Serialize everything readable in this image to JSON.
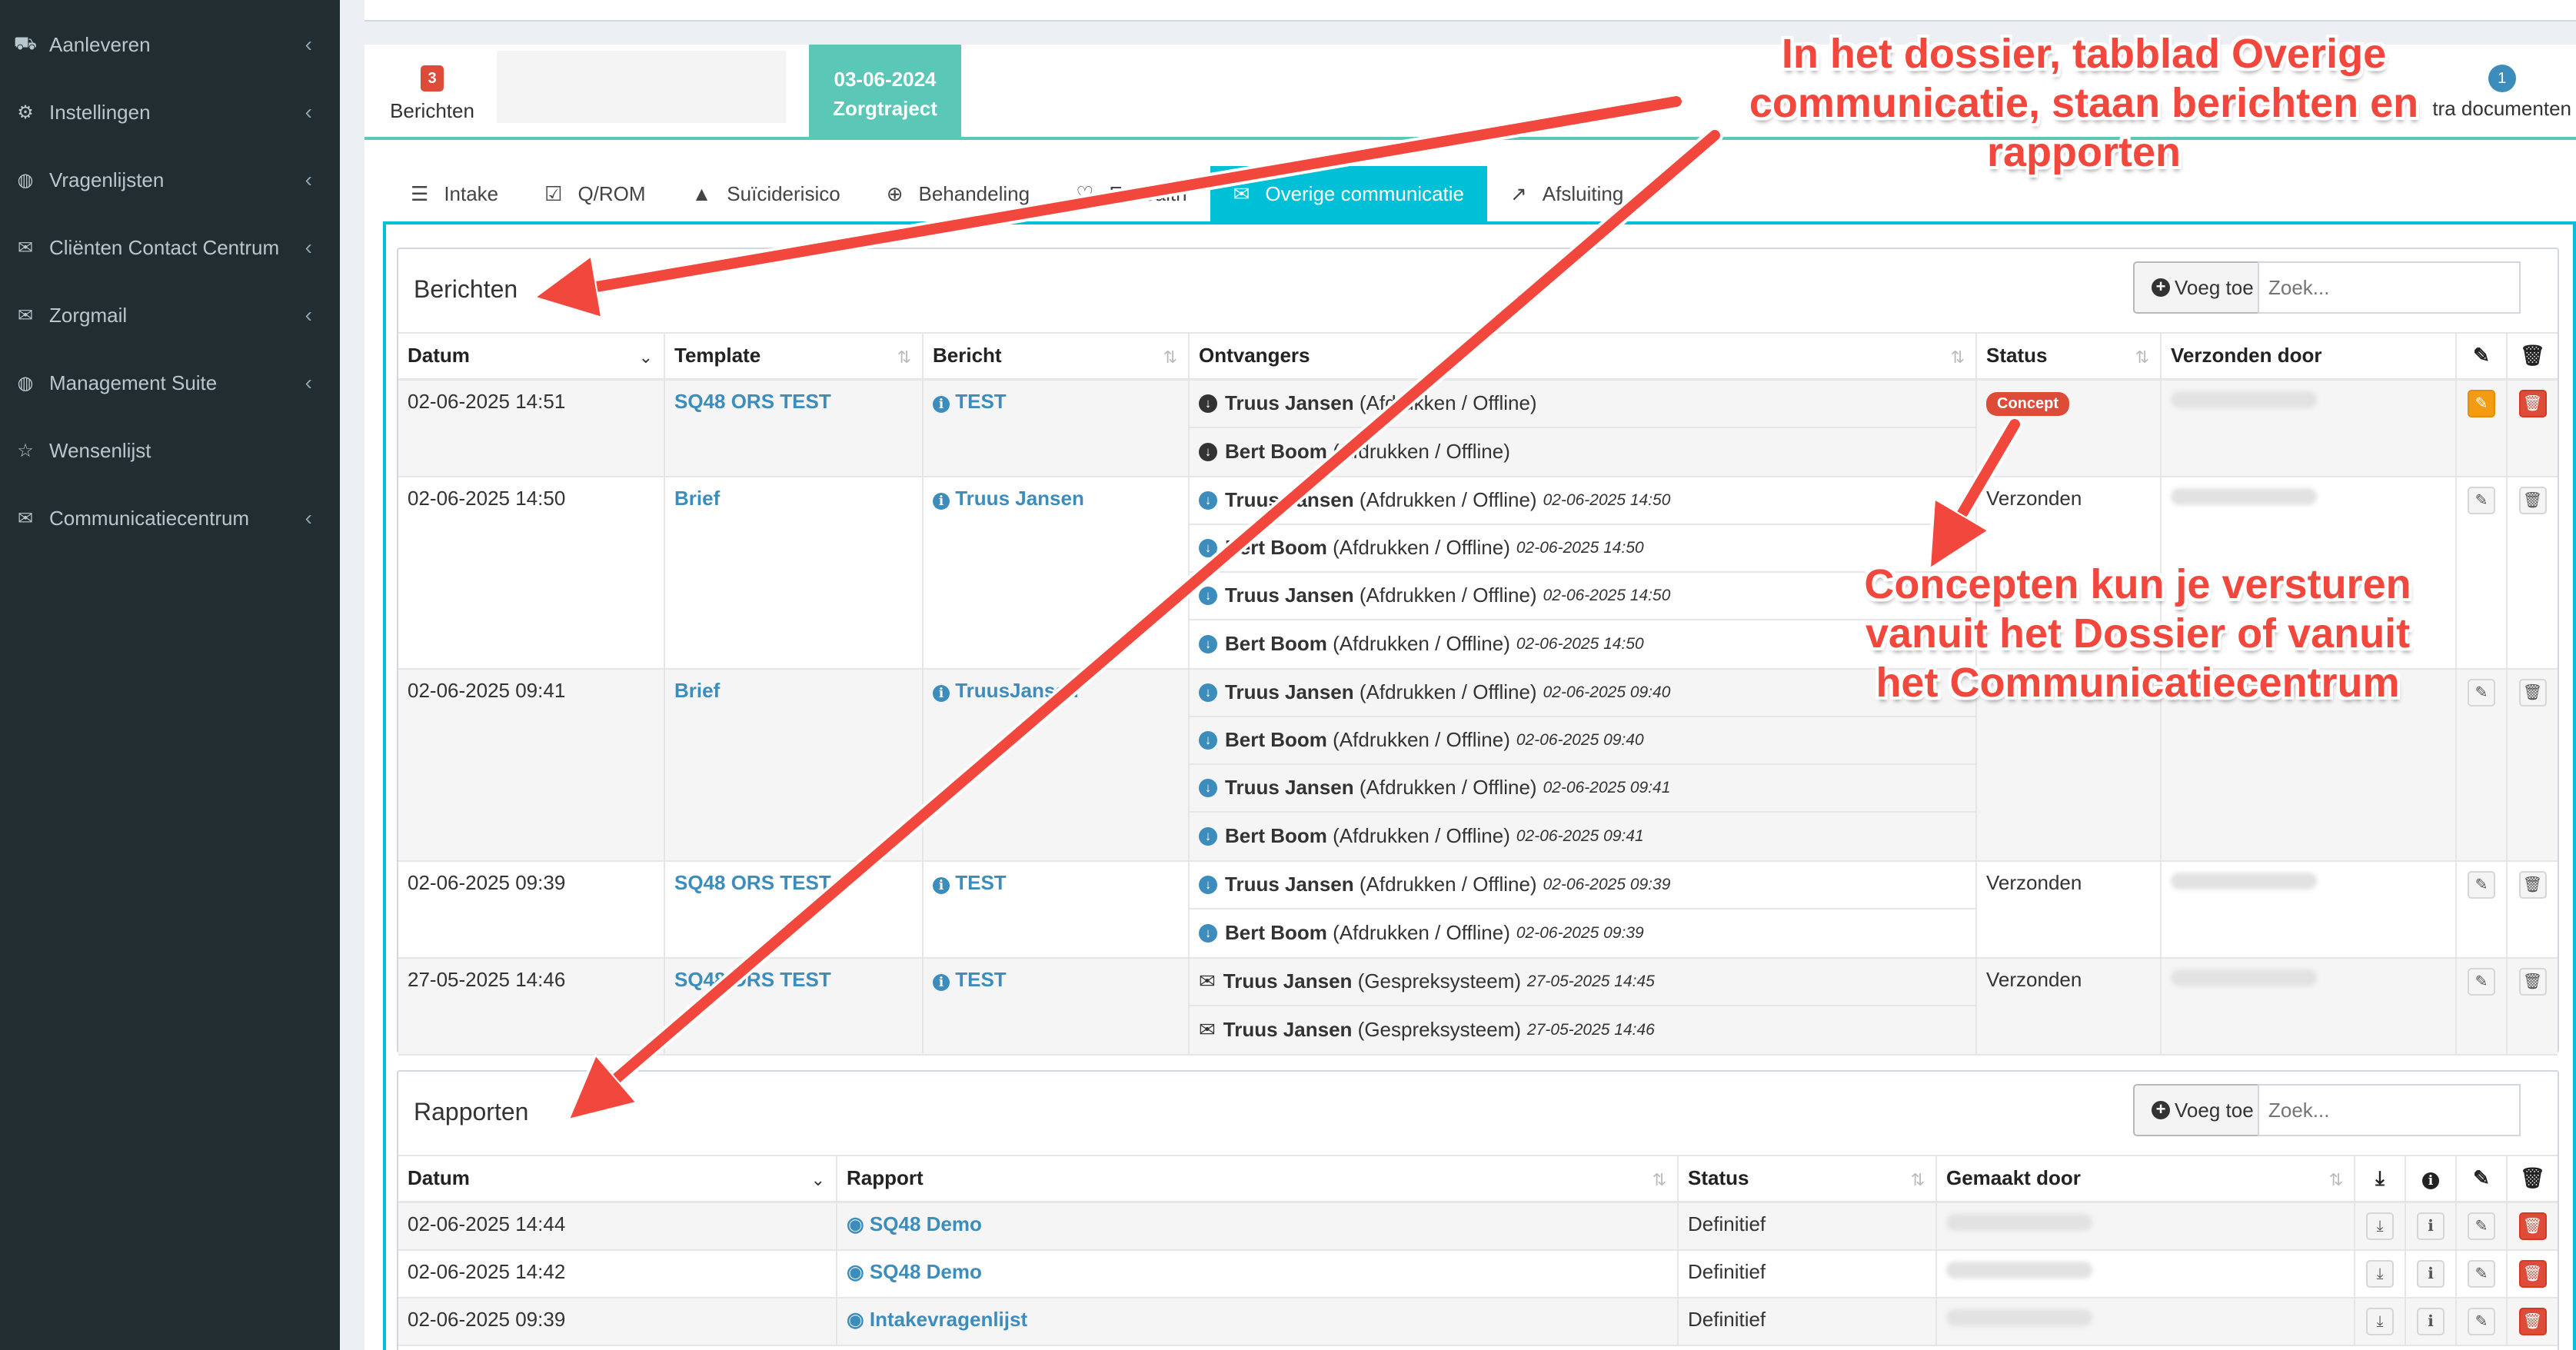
{
  "sidebar": {
    "items": [
      {
        "label": "Aanleveren",
        "icon": "truck-icon",
        "glyph": "⛟"
      },
      {
        "label": "Instellingen",
        "icon": "gear-icon",
        "glyph": "⚙"
      },
      {
        "label": "Vragenlijsten",
        "icon": "globe-icon",
        "glyph": "◍"
      },
      {
        "label": "Cliënten Contact Centrum",
        "icon": "envelope-icon",
        "glyph": "✉"
      },
      {
        "label": "Zorgmail",
        "icon": "envelope-icon",
        "glyph": "✉"
      },
      {
        "label": "Management Suite",
        "icon": "globe-icon",
        "glyph": "◍"
      },
      {
        "label": "Wensenlijst",
        "icon": "star-icon",
        "glyph": "☆"
      },
      {
        "label": "Communicatiecentrum",
        "icon": "envelope-icon",
        "glyph": "✉"
      }
    ]
  },
  "timeline": {
    "berichten_count": "3",
    "berichten_label": "Berichten",
    "active_date": "03-06-2024",
    "active_label": "Zorgtraject",
    "extra_count": "1",
    "extra_label": "tra documenten"
  },
  "tabs": [
    {
      "label": "Intake",
      "icon": "sliders-icon",
      "glyph": "☰"
    },
    {
      "label": "Q/ROM",
      "icon": "checkbox-icon",
      "glyph": "☑"
    },
    {
      "label": "Suïciderisico",
      "icon": "warning-icon",
      "glyph": "▲"
    },
    {
      "label": "Behandeling",
      "icon": "medkit-icon",
      "glyph": "⊕"
    },
    {
      "label": "E-Health",
      "icon": "stethoscope-icon",
      "glyph": "♡"
    },
    {
      "label": "Overige communicatie",
      "icon": "envelope-icon",
      "glyph": "✉"
    },
    {
      "label": "Afsluiting",
      "icon": "external-link-icon",
      "glyph": "↗"
    }
  ],
  "berichten": {
    "title": "Berichten",
    "add_label": "Voeg toe",
    "search_placeholder": "Zoek...",
    "columns": [
      "Datum",
      "Template",
      "Bericht",
      "Ontvangers",
      "Status",
      "Verzonden door"
    ],
    "rows": [
      {
        "datum": "02-06-2025 14:51",
        "template": "SQ48 ORS TEST",
        "bericht": "TEST",
        "status": "Concept",
        "recipients": [
          {
            "name": "Truus Jansen",
            "detail": "(Afdrukken / Offline)",
            "ts": "",
            "type": "download"
          },
          {
            "name": "Bert Boom",
            "detail": "(Afdrukken / Offline)",
            "ts": "",
            "type": "download"
          }
        ]
      },
      {
        "datum": "02-06-2025 14:50",
        "template": "Brief",
        "bericht": "Truus Jansen",
        "status": "Verzonden",
        "recipients": [
          {
            "name": "Truus Jansen",
            "detail": "(Afdrukken / Offline)",
            "ts": "02-06-2025 14:50",
            "type": "download"
          },
          {
            "name": "Bert Boom",
            "detail": "(Afdrukken / Offline)",
            "ts": "02-06-2025 14:50",
            "type": "download"
          },
          {
            "name": "Truus Jansen",
            "detail": "(Afdrukken / Offline)",
            "ts": "02-06-2025 14:50",
            "type": "download"
          },
          {
            "name": "Bert Boom",
            "detail": "(Afdrukken / Offline)",
            "ts": "02-06-2025 14:50",
            "type": "download"
          }
        ]
      },
      {
        "datum": "02-06-2025 09:41",
        "template": "Brief",
        "bericht": "TruusJansen",
        "status": "",
        "recipients": [
          {
            "name": "Truus Jansen",
            "detail": "(Afdrukken / Offline)",
            "ts": "02-06-2025 09:40",
            "type": "download"
          },
          {
            "name": "Bert Boom",
            "detail": "(Afdrukken / Offline)",
            "ts": "02-06-2025 09:40",
            "type": "download"
          },
          {
            "name": "Truus Jansen",
            "detail": "(Afdrukken / Offline)",
            "ts": "02-06-2025 09:41",
            "type": "download"
          },
          {
            "name": "Bert Boom",
            "detail": "(Afdrukken / Offline)",
            "ts": "02-06-2025 09:41",
            "type": "download"
          }
        ]
      },
      {
        "datum": "02-06-2025 09:39",
        "template": "SQ48 ORS TEST",
        "bericht": "TEST",
        "status": "Verzonden",
        "recipients": [
          {
            "name": "Truus Jansen",
            "detail": "(Afdrukken / Offline)",
            "ts": "02-06-2025 09:39",
            "type": "download"
          },
          {
            "name": "Bert Boom",
            "detail": "(Afdrukken / Offline)",
            "ts": "02-06-2025 09:39",
            "type": "download"
          }
        ]
      },
      {
        "datum": "27-05-2025 14:46",
        "template": "SQ48 ORS TEST",
        "bericht": "TEST",
        "status": "Verzonden",
        "recipients": [
          {
            "name": "Truus Jansen",
            "detail": "(Gespreksysteem)",
            "ts": "27-05-2025 14:45",
            "type": "envelope"
          },
          {
            "name": "Truus Jansen",
            "detail": "(Gespreksysteem)",
            "ts": "27-05-2025 14:46",
            "type": "envelope"
          }
        ]
      }
    ]
  },
  "rapporten": {
    "title": "Rapporten",
    "add_label": "Voeg toe",
    "search_placeholder": "Zoek...",
    "columns": [
      "Datum",
      "Rapport",
      "Status",
      "Gemaakt door"
    ],
    "rows": [
      {
        "datum": "02-06-2025 14:44",
        "rapport": "SQ48 Demo",
        "status": "Definitief"
      },
      {
        "datum": "02-06-2025 14:42",
        "rapport": "SQ48 Demo",
        "status": "Definitief"
      },
      {
        "datum": "02-06-2025 09:39",
        "rapport": "Intakevragenlijst",
        "status": "Definitief"
      }
    ]
  },
  "annotations": {
    "top": "In het dossier, tabblad Overige communicatie, staan berichten en rapporten",
    "middle": "Concepten kun je versturen vanuit het Dossier of vanuit het Communicatiecentrum"
  },
  "colors": {
    "accent": "#00c0d8",
    "timeline": "#5bc7b6",
    "link": "#3c8dbc",
    "danger": "#dd4b39",
    "warning": "#f39c12",
    "annotation": "#f2473c",
    "sidebar": "#222d32"
  }
}
